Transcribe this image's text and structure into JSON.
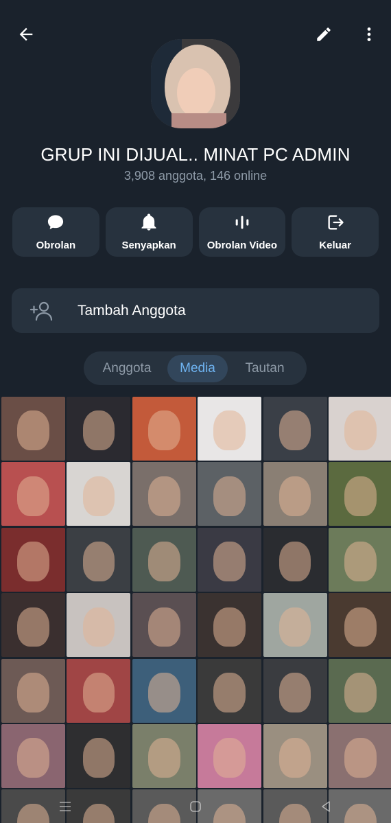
{
  "header": {
    "back_icon": "arrow-left-icon",
    "edit_icon": "pencil-icon",
    "more_icon": "more-vertical-icon"
  },
  "group": {
    "title": "GRUP INI DIJUAL.. MINAT PC ADMIN",
    "subtitle": "3,908 anggota, 146 online"
  },
  "actions": [
    {
      "label": "Obrolan",
      "icon": "chat-bubble-icon"
    },
    {
      "label": "Senyapkan",
      "icon": "bell-icon"
    },
    {
      "label": "Obrolan Video",
      "icon": "voice-chat-icon"
    },
    {
      "label": "Keluar",
      "icon": "leave-icon"
    }
  ],
  "add_member": {
    "label": "Tambah Anggota",
    "icon": "add-person-icon"
  },
  "tabs": [
    {
      "label": "Anggota",
      "active": false
    },
    {
      "label": "Media",
      "active": true
    },
    {
      "label": "Tautan",
      "active": false
    }
  ],
  "colors": {
    "background": "#1a222c",
    "card": "#27323e",
    "accent": "#6fb4f2",
    "muted_text": "#8e9aa7"
  },
  "system_nav": {
    "recents_icon": "recents-icon",
    "home_icon": "home-icon",
    "back_icon": "system-back-icon"
  }
}
